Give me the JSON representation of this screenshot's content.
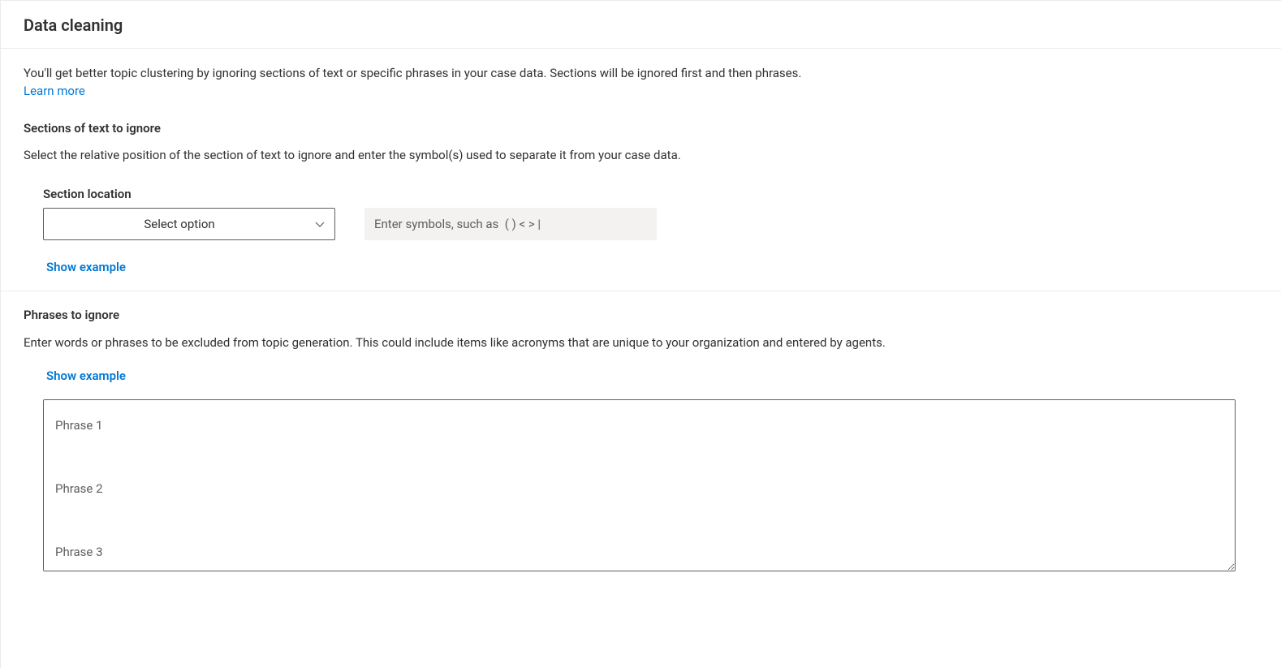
{
  "header": {
    "title": "Data cleaning"
  },
  "intro": {
    "description": "You'll get better topic clustering by ignoring sections of text or specific phrases in your case data. Sections will be ignored first and then phrases.",
    "learn_more": "Learn more"
  },
  "sections": {
    "heading": "Sections of text to ignore",
    "description": "Select the relative position of the section of text to ignore and enter the symbol(s) used to separate it from your case data.",
    "location_label": "Section location",
    "select_placeholder": "Select option",
    "symbols_placeholder": "Enter symbols, such as  ( ) < > |",
    "show_example": "Show example"
  },
  "phrases": {
    "heading": "Phrases to ignore",
    "description": "Enter words or phrases to be excluded from topic generation. This could include items like acronyms that are unique to your organization and entered by agents.",
    "show_example": "Show example",
    "textarea_placeholder": "Phrase 1\n\nPhrase 2\n\nPhrase 3"
  }
}
